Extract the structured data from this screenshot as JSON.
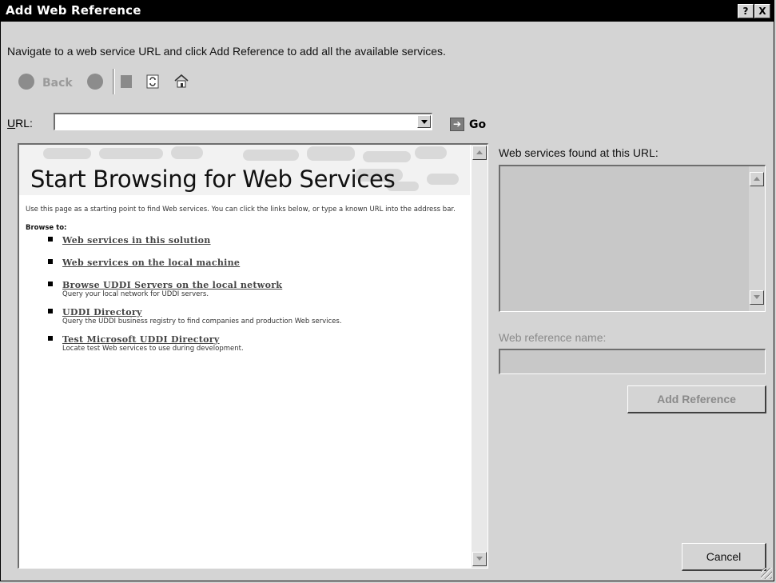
{
  "window": {
    "title": "Add Web Reference",
    "help_button": "?",
    "close_button": "X"
  },
  "instruction": "Navigate to a web service URL and click Add Reference to add all the available services.",
  "toolbar": {
    "back_label": "Back",
    "icons": [
      "back-icon",
      "forward-icon",
      "stop-icon",
      "refresh-icon",
      "home-icon"
    ]
  },
  "url": {
    "label_prefix": "U",
    "label_rest": "RL:",
    "value": "",
    "go_label": "Go"
  },
  "browser": {
    "heading": "Start Browsing for Web Services",
    "intro": "Use this page as a starting point to find Web services. You can click the links below, or type a known URL into the address bar.",
    "browse_to": "Browse to:",
    "links": [
      {
        "label": "Web services in this solution",
        "desc": ""
      },
      {
        "label": "Web services on the local machine",
        "desc": ""
      },
      {
        "label": "Browse UDDI Servers on the local network",
        "desc": "Query your local network for UDDI servers."
      },
      {
        "label": "UDDI Directory",
        "desc": "Query the UDDI business registry to find companies and production Web services."
      },
      {
        "label": "Test Microsoft UDDI Directory",
        "desc": "Locate test Web services to use during development."
      }
    ]
  },
  "right_panel": {
    "found_label": "Web services found at this URL:",
    "ref_name_label": "Web reference name:",
    "ref_name_value": "",
    "add_reference": "Add Reference",
    "cancel": "Cancel"
  }
}
